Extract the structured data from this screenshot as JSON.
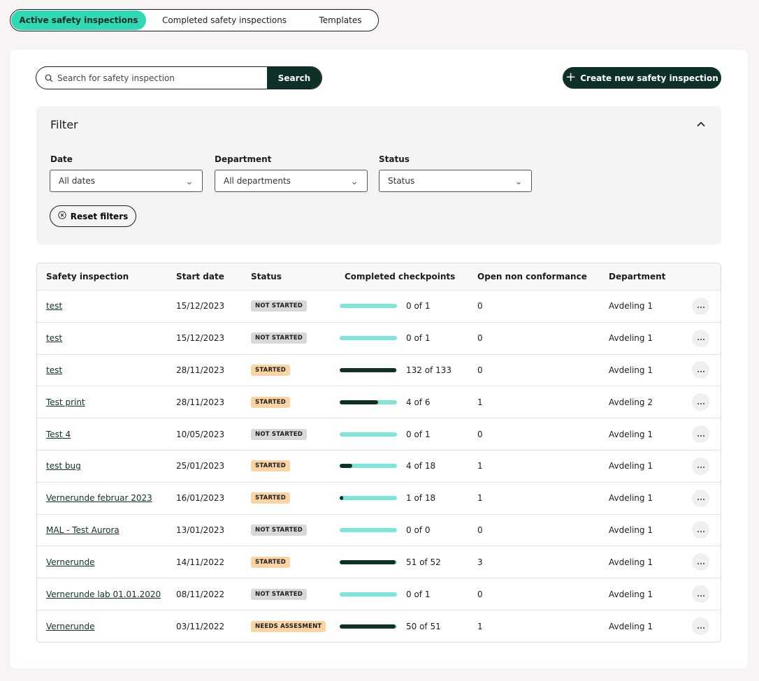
{
  "tabs": [
    {
      "label": "Active safety inspections",
      "active": true
    },
    {
      "label": "Completed safety inspections",
      "active": false
    },
    {
      "label": "Templates",
      "active": false
    }
  ],
  "search": {
    "placeholder": "Search for safety inspection",
    "button_label": "Search"
  },
  "create_button": {
    "label": "Create new safety inspection",
    "icon": "plus-icon"
  },
  "filter": {
    "title": "Filter",
    "date": {
      "label": "Date",
      "value": "All dates"
    },
    "department": {
      "label": "Department",
      "value": "All departments"
    },
    "status": {
      "label": "Status",
      "value": "Status"
    },
    "reset_label": "Reset filters"
  },
  "colors": {
    "accent": "#2ed9b3",
    "dark": "#0d3028",
    "progress_track": "#7ee6d6",
    "badge_not_started": "#d8d8d8",
    "badge_started": "#fcd3a3"
  },
  "table": {
    "headers": [
      "Safety inspection",
      "Start date",
      "Status",
      "Completed checkpoints",
      "Open non conformance",
      "Department"
    ],
    "rows": [
      {
        "name": "test",
        "date": "15/12/2023",
        "status": "NOT STARTED",
        "status_kind": "ns",
        "done": 0,
        "total": 1,
        "progress_text": "0 of 1",
        "nc": "0",
        "dept": "Avdeling 1"
      },
      {
        "name": "test",
        "date": "15/12/2023",
        "status": "NOT STARTED",
        "status_kind": "ns",
        "done": 0,
        "total": 1,
        "progress_text": "0 of 1",
        "nc": "0",
        "dept": "Avdeling 1"
      },
      {
        "name": "test",
        "date": "28/11/2023",
        "status": "STARTED",
        "status_kind": "st",
        "done": 132,
        "total": 133,
        "progress_text": "132 of 133",
        "nc": "0",
        "dept": "Avdeling 1"
      },
      {
        "name": "Test print",
        "date": "28/11/2023",
        "status": "STARTED",
        "status_kind": "st",
        "done": 4,
        "total": 6,
        "progress_text": "4 of 6",
        "nc": "1",
        "dept": "Avdeling 2"
      },
      {
        "name": "Test 4",
        "date": "10/05/2023",
        "status": "NOT STARTED",
        "status_kind": "ns",
        "done": 0,
        "total": 1,
        "progress_text": "0 of 1",
        "nc": "0",
        "dept": "Avdeling 1"
      },
      {
        "name": "test bug",
        "date": "25/01/2023",
        "status": "STARTED",
        "status_kind": "st",
        "done": 4,
        "total": 18,
        "progress_text": "4 of 18",
        "nc": "1",
        "dept": "Avdeling 1"
      },
      {
        "name": "Vernerunde februar 2023",
        "date": "16/01/2023",
        "status": "STARTED",
        "status_kind": "st",
        "done": 1,
        "total": 18,
        "progress_text": "1 of 18",
        "nc": "1",
        "dept": "Avdeling 1"
      },
      {
        "name": "MAL - Test Aurora",
        "date": "13/01/2023",
        "status": "NOT STARTED",
        "status_kind": "ns",
        "done": 0,
        "total": 0,
        "progress_text": "0 of 0",
        "nc": "0",
        "dept": "Avdeling 1"
      },
      {
        "name": "Vernerunde",
        "date": "14/11/2022",
        "status": "STARTED",
        "status_kind": "st",
        "done": 51,
        "total": 52,
        "progress_text": "51 of 52",
        "nc": "3",
        "dept": "Avdeling 1"
      },
      {
        "name": "Vernerunde lab 01.01.2020",
        "date": "08/11/2022",
        "status": "NOT STARTED",
        "status_kind": "ns",
        "done": 0,
        "total": 1,
        "progress_text": "0 of 1",
        "nc": "0",
        "dept": "Avdeling 1"
      },
      {
        "name": "Vernerunde",
        "date": "03/11/2022",
        "status": "NEEDS ASSESMENT",
        "status_kind": "st",
        "done": 50,
        "total": 51,
        "progress_text": "50 of 51",
        "nc": "1",
        "dept": "Avdeling 1"
      }
    ]
  }
}
